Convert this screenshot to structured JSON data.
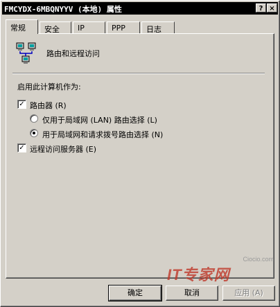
{
  "window": {
    "title": "FMCYDX-6MBQNYYV (本地) 属性",
    "help_button": "?",
    "close_button": "×"
  },
  "tabs": [
    {
      "label": "常规",
      "active": true
    },
    {
      "label": "安全",
      "active": false
    },
    {
      "label": "IP",
      "active": false
    },
    {
      "label": "PPP",
      "active": false
    },
    {
      "label": "日志",
      "active": false
    }
  ],
  "header": {
    "icon": "routing-network-icon",
    "title": "路由和远程访问"
  },
  "enable_section": {
    "label": "启用此计算机作为:",
    "router_checkbox": {
      "label": "路由器 (R)",
      "checked": true
    },
    "router_options": [
      {
        "label": "仅用于局域网 (LAN) 路由选择 (L)",
        "selected": false
      },
      {
        "label": "用于局域网和请求拨号路由选择 (N)",
        "selected": true
      }
    ],
    "remote_access_checkbox": {
      "label": "远程访问服务器 (E)",
      "checked": true
    }
  },
  "buttons": {
    "ok": "确定",
    "cancel": "取消",
    "apply": "应用 (A)"
  },
  "watermark": {
    "site": "Ciocio.com",
    "logo": "IT专家网"
  },
  "colors": {
    "face": "#d4d0c8",
    "titlebar": "#000000",
    "watermark": "#c0392b"
  }
}
